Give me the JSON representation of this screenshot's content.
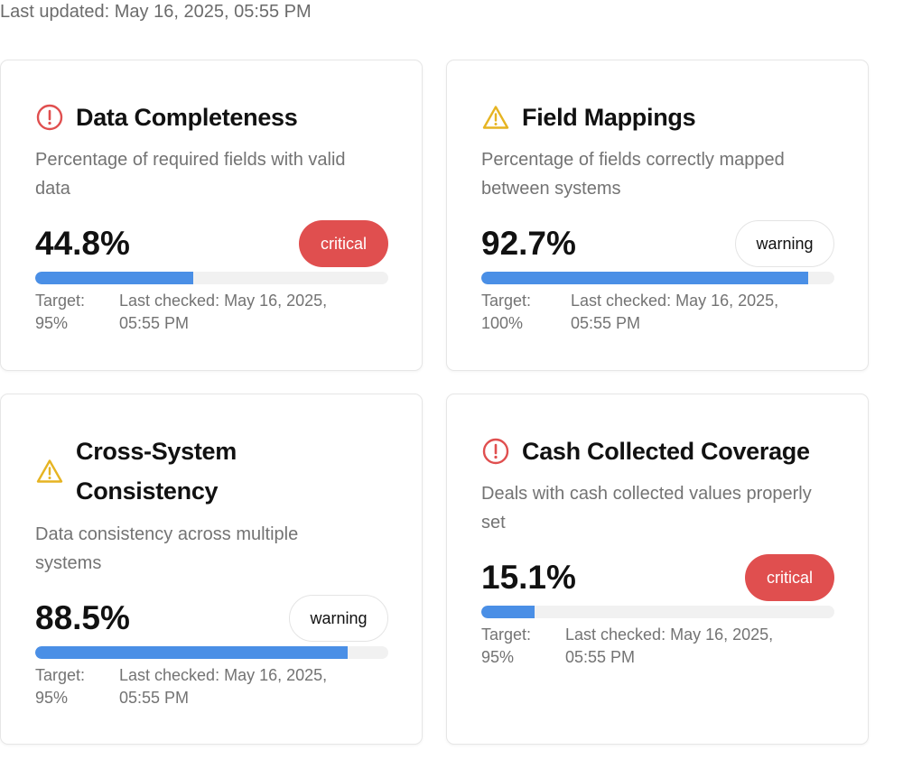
{
  "last_updated": "Last updated: May 16, 2025, 05:55 PM",
  "colors": {
    "critical": "#e04f4f",
    "warning_icon": "#e6b422",
    "progress": "#4a8fe6",
    "track": "#f1f1f1"
  },
  "cards": [
    {
      "icon": "alert-circle-icon",
      "title": "Data Completeness",
      "description": "Percentage of required fields with valid data",
      "value": "44.8%",
      "progress_percent": 44.8,
      "status": "critical",
      "target_label": "Target:",
      "target_value": "95%",
      "last_checked": "Last checked: May 16, 2025, 05:55 PM"
    },
    {
      "icon": "warning-triangle-icon",
      "title": "Field Mappings",
      "description": "Percentage of fields correctly mapped between systems",
      "value": "92.7%",
      "progress_percent": 92.7,
      "status": "warning",
      "target_label": "Target:",
      "target_value": "100%",
      "last_checked": "Last checked: May 16, 2025, 05:55 PM"
    },
    {
      "icon": "warning-triangle-icon",
      "title": "Cross-System Consistency",
      "description": "Data consistency across multiple systems",
      "value": "88.5%",
      "progress_percent": 88.5,
      "status": "warning",
      "target_label": "Target:",
      "target_value": "95%",
      "last_checked": "Last checked: May 16, 2025, 05:55 PM"
    },
    {
      "icon": "alert-circle-icon",
      "title": "Cash Collected Coverage",
      "description": "Deals with cash collected values properly set",
      "value": "15.1%",
      "progress_percent": 15.1,
      "status": "critical",
      "target_label": "Target:",
      "target_value": "95%",
      "last_checked": "Last checked: May 16, 2025, 05:55 PM"
    }
  ]
}
